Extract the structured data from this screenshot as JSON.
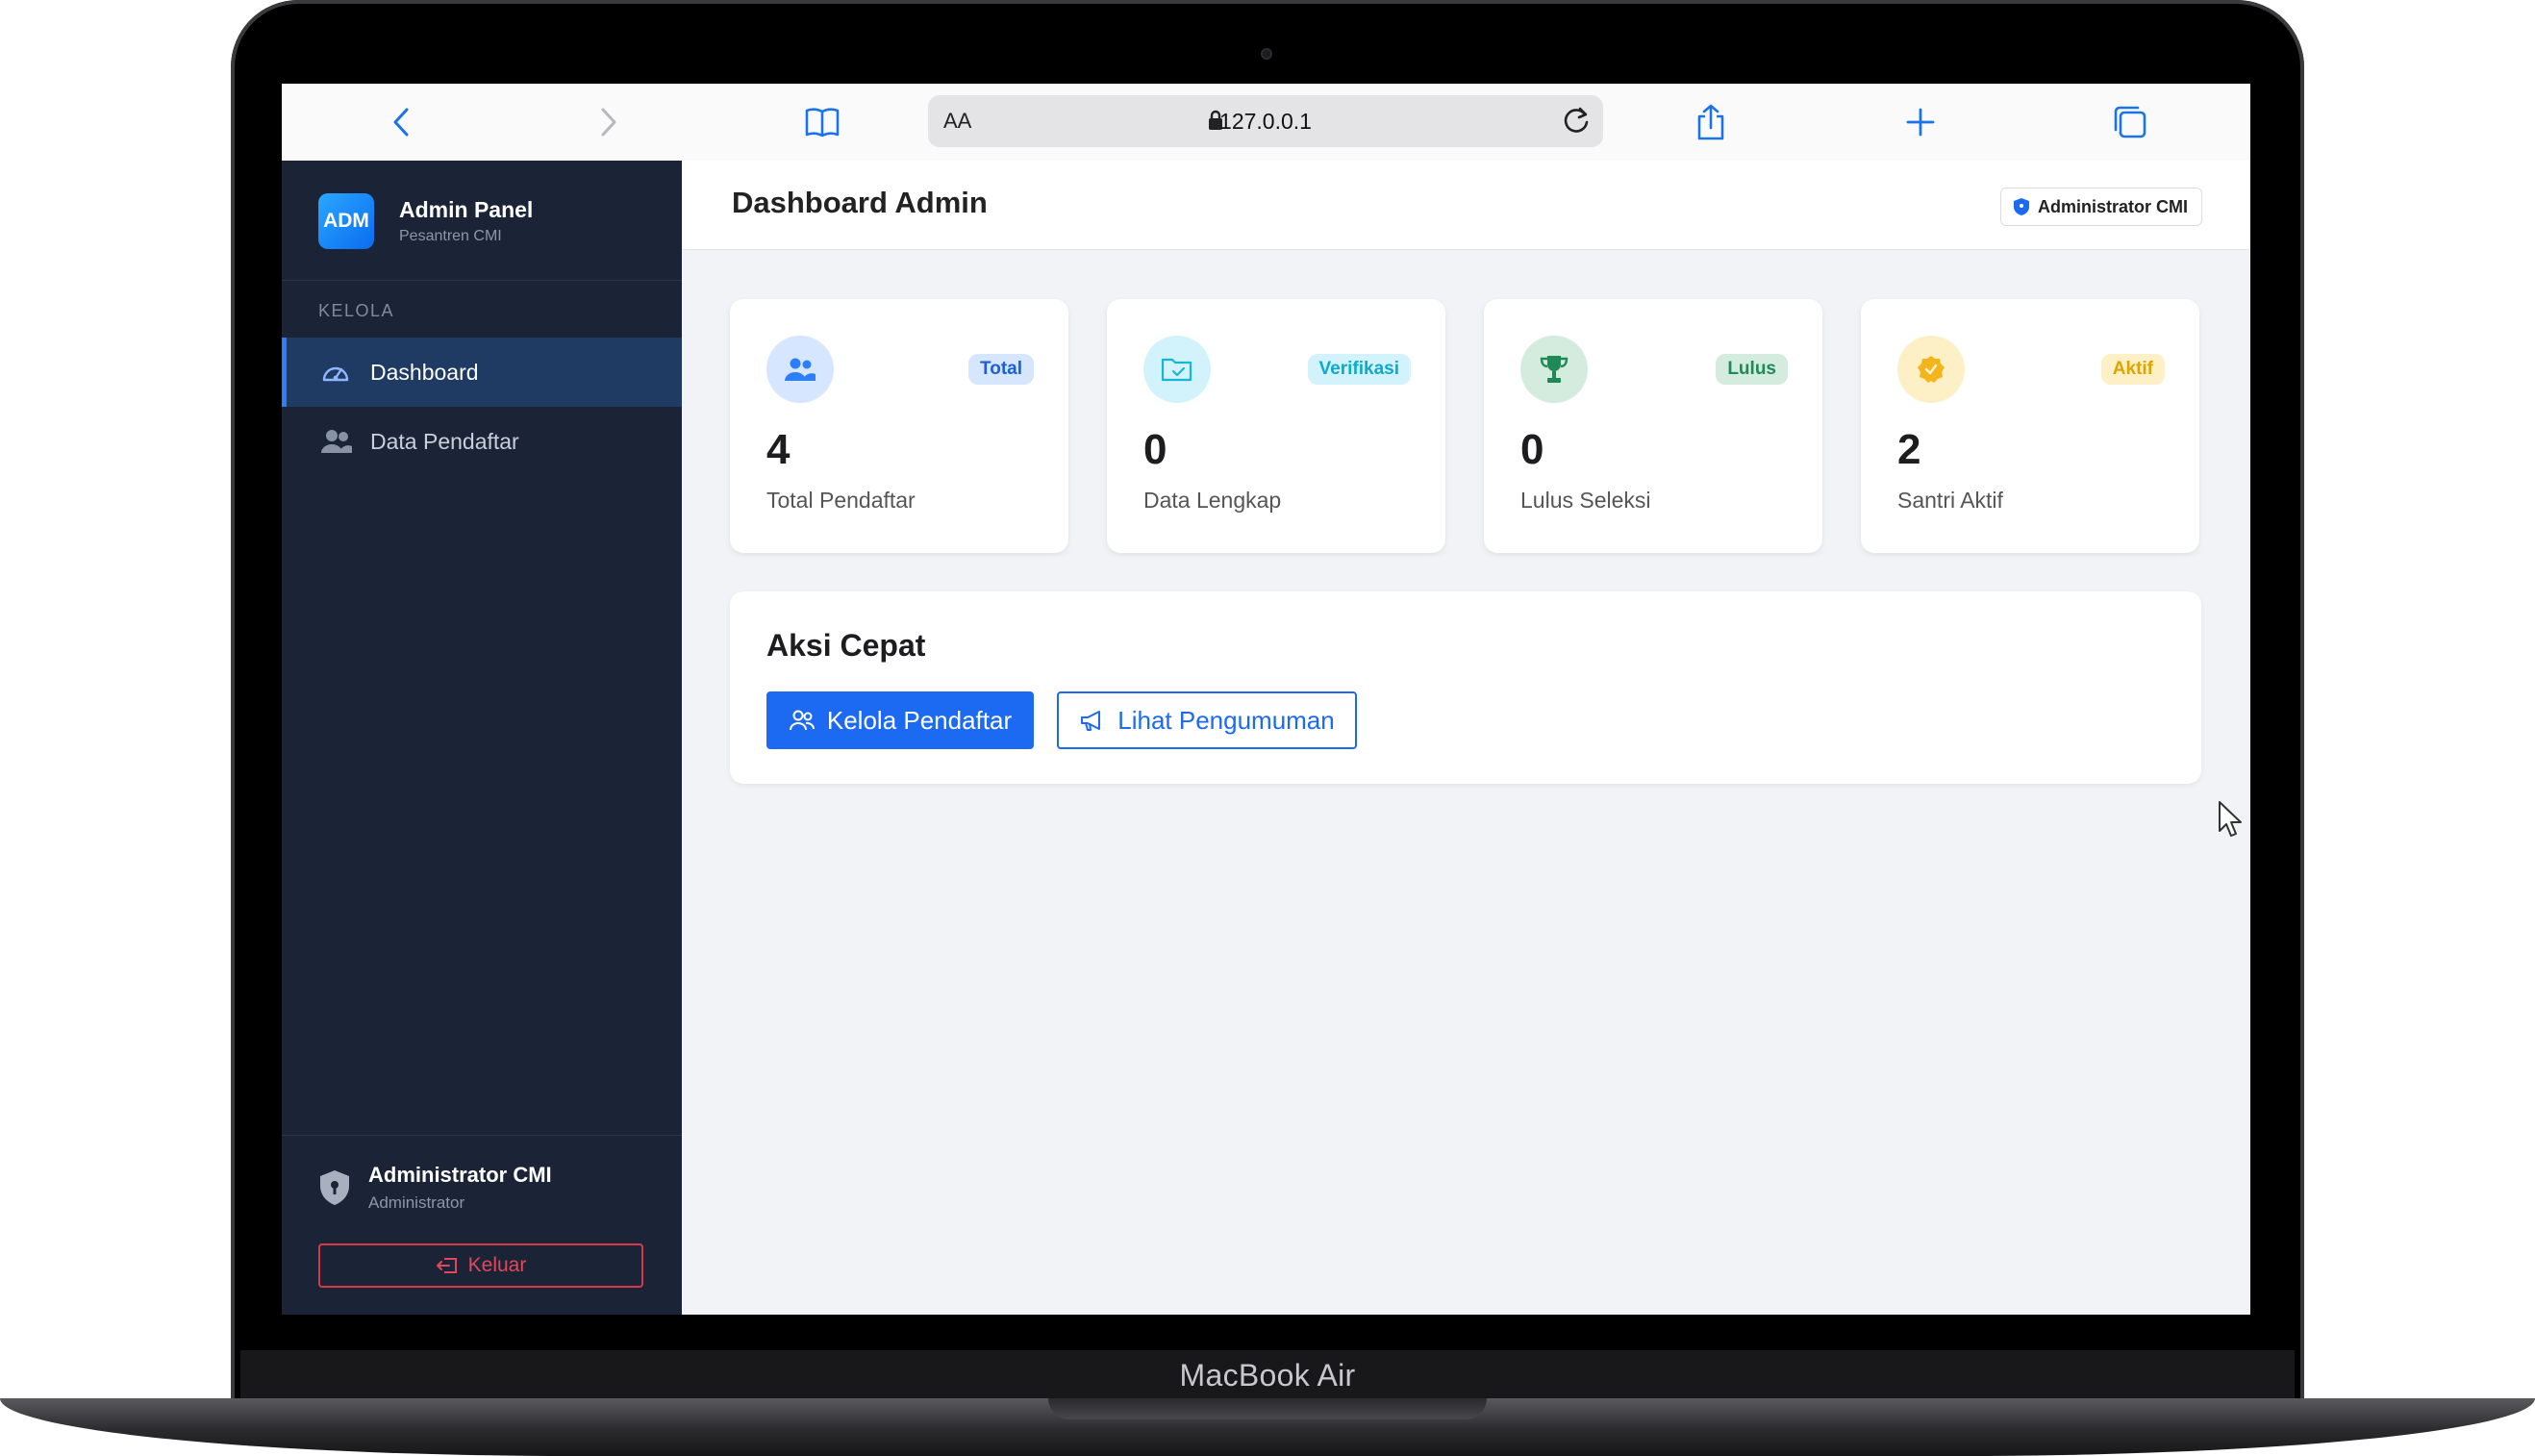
{
  "device": {
    "label": "MacBook Air"
  },
  "browser": {
    "text_size_label": "AA",
    "url_host": "127.0.0.1",
    "icons": [
      "chevron-left-icon",
      "chevron-right-icon",
      "book-icon",
      "lock-icon",
      "reload-icon",
      "share-icon",
      "plus-icon",
      "tabs-icon"
    ]
  },
  "sidebar": {
    "logo_text": "ADM",
    "brand_title": "Admin Panel",
    "brand_subtitle": "Pesantren CMI",
    "section_label": "KELOLA",
    "items": [
      {
        "label": "Dashboard",
        "icon": "gauge-icon",
        "active": true
      },
      {
        "label": "Data Pendaftar",
        "icon": "users-icon",
        "active": false
      }
    ],
    "user": {
      "name": "Administrator CMI",
      "role": "Administrator"
    },
    "logout_label": "Keluar"
  },
  "header": {
    "title": "Dashboard Admin",
    "badge": "Administrator CMI"
  },
  "stats": [
    {
      "badge": "Total",
      "value": "4",
      "caption": "Total Pendaftar",
      "icon": "users-icon",
      "color": "#2d7ff9"
    },
    {
      "badge": "Verifikasi",
      "value": "0",
      "caption": "Data Lengkap",
      "icon": "folder-check-icon",
      "color": "#17b6d8"
    },
    {
      "badge": "Lulus",
      "value": "0",
      "caption": "Lulus Seleksi",
      "icon": "trophy-icon",
      "color": "#1f8a57"
    },
    {
      "badge": "Aktif",
      "value": "2",
      "caption": "Santri Aktif",
      "icon": "badge-check-icon",
      "color": "#f3b51b"
    }
  ],
  "quick_actions": {
    "title": "Aksi Cepat",
    "primary_label": "Kelola Pendaftar",
    "secondary_label": "Lihat Pengumuman"
  },
  "colors": {
    "accent": "#1d6af2",
    "sidebar_bg": "#1b2436",
    "danger": "#d8384a"
  }
}
